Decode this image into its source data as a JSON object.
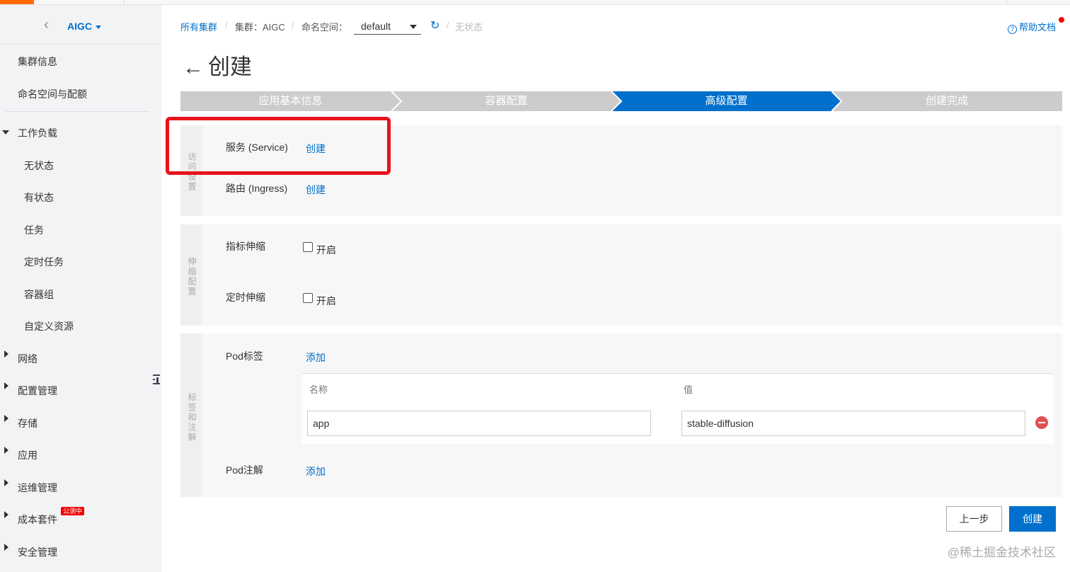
{
  "sidebar": {
    "cluster_name": "AIGC",
    "items": [
      {
        "label": "集群信息"
      },
      {
        "label": "命名空间与配额"
      },
      {
        "label": "工作负载"
      },
      {
        "label": "无状态"
      },
      {
        "label": "有状态"
      },
      {
        "label": "任务"
      },
      {
        "label": "定时任务"
      },
      {
        "label": "容器组"
      },
      {
        "label": "自定义资源"
      },
      {
        "label": "网络"
      },
      {
        "label": "配置管理"
      },
      {
        "label": "存储"
      },
      {
        "label": "应用"
      },
      {
        "label": "运维管理"
      },
      {
        "label": "成本套件"
      },
      {
        "label": "安全管理"
      }
    ],
    "beta_badge": "公测中"
  },
  "breadcrumb": {
    "all_clusters": "所有集群",
    "cluster": "集群：AIGC",
    "namespace_label": "命名空间：",
    "namespace_value": "default",
    "current": "无状态"
  },
  "help": {
    "label": "帮助文档"
  },
  "page": {
    "title": "创建"
  },
  "steps": [
    {
      "label": "应用基本信息",
      "active": false
    },
    {
      "label": "容器配置",
      "active": false
    },
    {
      "label": "高级配置",
      "active": true
    },
    {
      "label": "创建完成",
      "active": false
    }
  ],
  "access": {
    "section_title": "访问设置",
    "service_label": "服务 (Service)",
    "service_link": "创建",
    "ingress_label": "路由 (Ingress)",
    "ingress_link": "创建"
  },
  "scaling": {
    "section_title": "伸缩配置",
    "hpa_label": "指标伸缩",
    "hpa_option": "开启",
    "cron_label": "定时伸缩",
    "cron_option": "开启"
  },
  "labels": {
    "section_title": "标签和注解",
    "pod_labels": "Pod标签",
    "add_label": "添加",
    "col_name": "名称",
    "col_value": "值",
    "rows": [
      {
        "name": "app",
        "value": "stable-diffusion"
      }
    ],
    "pod_annotations": "Pod注解",
    "add_annotation": "添加"
  },
  "footer": {
    "prev": "上一步",
    "create": "创建"
  },
  "watermark": "@稀土掘金技术社区",
  "colors": {
    "accent": "#0070cc",
    "step_inactive": "#cccccc",
    "highlight": "#e8131b"
  }
}
